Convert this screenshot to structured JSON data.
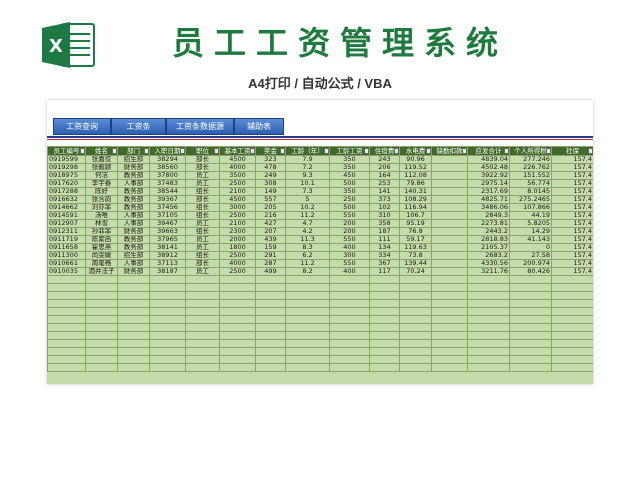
{
  "header": {
    "title": "员工工资管理系统",
    "subtitle": "A4打印 / 自动公式 / VBA",
    "logo_letter": "X"
  },
  "colors": {
    "title_green": "#1f7a3d",
    "logo_green": "#1d7a44",
    "tab_blue": "#2d5fb0",
    "header_row": "#3f6a2a",
    "cell_green": "#c5dcaa"
  },
  "toolbar": {
    "tabs": [
      "工资查询",
      "工资条",
      "工资条数据源",
      "辅助表"
    ]
  },
  "table": {
    "columns": [
      "员工编号",
      "姓名",
      "部门",
      "入职日期",
      "职位",
      "基本工资",
      "奖金",
      "工龄（年）",
      "工龄工资",
      "住宿费",
      "水电费",
      "缺勤扣款",
      "应发合计",
      "个人所得税",
      "社保"
    ],
    "rows": [
      [
        "0919599",
        "张嘉佼",
        "招生部",
        "38294",
        "部长",
        "4500",
        "323",
        "7.9",
        "350",
        "243",
        "90.96",
        "",
        "4839.04",
        "277.246",
        "157.4"
      ],
      [
        "0919298",
        "张靓颖",
        "财务部",
        "38560",
        "部长",
        "4000",
        "478",
        "7.2",
        "350",
        "206",
        "119.52",
        "",
        "4502.48",
        "226.762",
        "157.4"
      ],
      [
        "0918975",
        "何洁",
        "教务部",
        "37800",
        "员工",
        "3500",
        "249",
        "9.3",
        "450",
        "164",
        "112.08",
        "",
        "3922.92",
        "151.552",
        "157.4"
      ],
      [
        "0917620",
        "李宇春",
        "人事部",
        "37483",
        "员工",
        "2500",
        "308",
        "10.1",
        "500",
        "253",
        "79.86",
        "",
        "2975.14",
        "56.774",
        "157.4"
      ],
      [
        "0917288",
        "陈好",
        "教务部",
        "38544",
        "组长",
        "2100",
        "149",
        "7.3",
        "350",
        "141",
        "140.31",
        "",
        "2317.69",
        "8.0145",
        "157.4"
      ],
      [
        "0916632",
        "张含韵",
        "教务部",
        "39367",
        "部长",
        "4500",
        "557",
        "5",
        "250",
        "373",
        "108.29",
        "",
        "4825.71",
        "275.2465",
        "157.4"
      ],
      [
        "0914662",
        "刘亦菲",
        "教务部",
        "37456",
        "组长",
        "3000",
        "205",
        "10.2",
        "500",
        "102",
        "116.94",
        "",
        "3486.06",
        "107.866",
        "157.4"
      ],
      [
        "0914591",
        "汤唯",
        "人事部",
        "37105",
        "组长",
        "2500",
        "216",
        "11.2",
        "550",
        "310",
        "106.7",
        "",
        "2849.3",
        "44.19",
        "157.4"
      ],
      [
        "0912907",
        "林雪",
        "人事部",
        "39467",
        "员工",
        "2100",
        "427",
        "4.7",
        "200",
        "358",
        "95.19",
        "",
        "2273.81",
        "5.8205",
        "157.4"
      ],
      [
        "0912311",
        "孙菲菲",
        "财务部",
        "39663",
        "组长",
        "2300",
        "207",
        "4.2",
        "200",
        "187",
        "76.8",
        "",
        "2443.2",
        "14.29",
        "157.4"
      ],
      [
        "0911719",
        "陈紫函",
        "教务部",
        "37965",
        "员工",
        "2000",
        "439",
        "11.3",
        "550",
        "111",
        "59.17",
        "",
        "2818.83",
        "41.143",
        "157.4"
      ],
      [
        "0911658",
        "霍思燕",
        "教务部",
        "38141",
        "员工",
        "1800",
        "159",
        "8.3",
        "400",
        "134",
        "119.63",
        "",
        "2105.37",
        "0",
        "157.4"
      ],
      [
        "0911300",
        "尚雯婕",
        "招生部",
        "38912",
        "组长",
        "2500",
        "291",
        "6.2",
        "300",
        "334",
        "73.8",
        "",
        "2683.2",
        "27.58",
        "157.4"
      ],
      [
        "0910661",
        "周笔畅",
        "人事部",
        "37113",
        "部长",
        "4000",
        "287",
        "11.2",
        "550",
        "367",
        "139.44",
        "",
        "4330.56",
        "200.974",
        "157.4"
      ],
      [
        "0910035",
        "酒井法子",
        "财务部",
        "38187",
        "员工",
        "2500",
        "499",
        "8.2",
        "400",
        "117",
        "70.24",
        "",
        "3211.76",
        "80.426",
        "157.4"
      ]
    ],
    "empty_rows": 12
  }
}
